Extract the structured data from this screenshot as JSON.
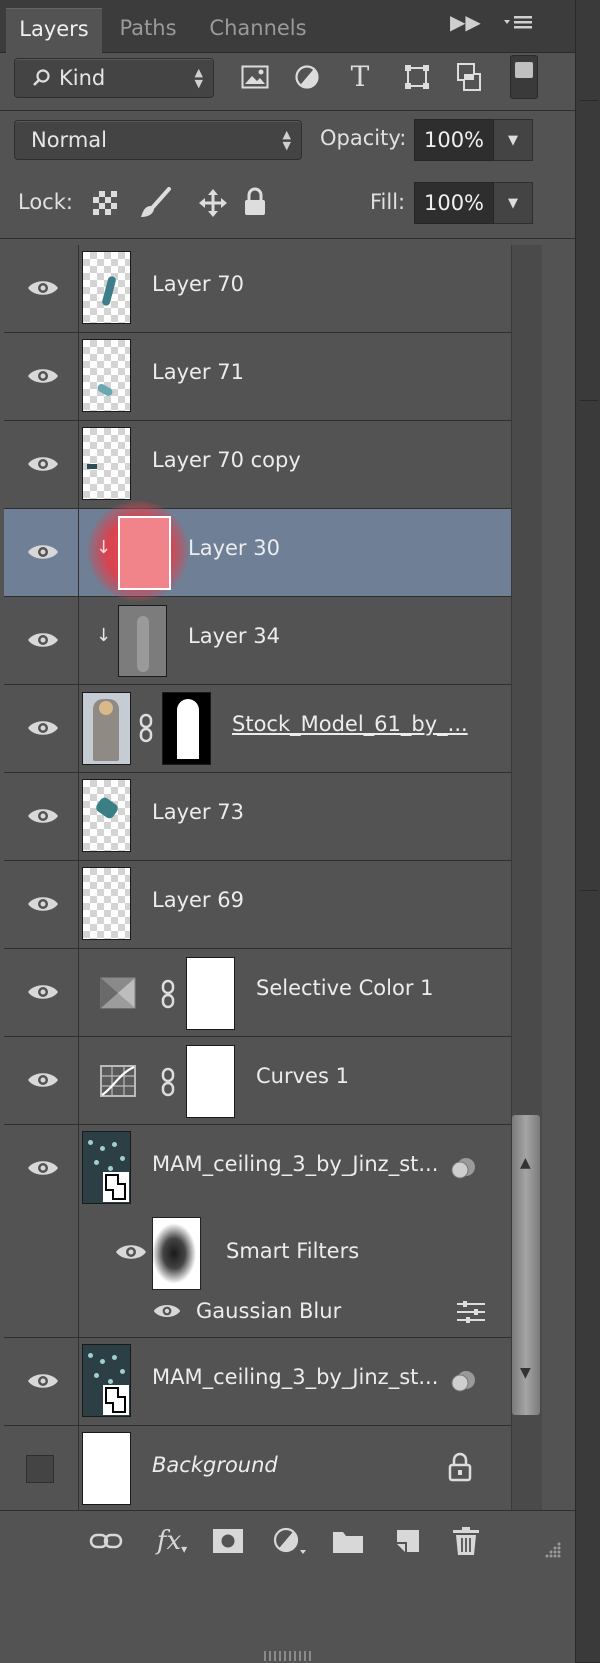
{
  "tabs": [
    "Layers",
    "Paths",
    "Channels"
  ],
  "active_tab": "Layers",
  "filter": {
    "label": "Kind"
  },
  "filter_icons": [
    "image-filter-icon",
    "adjustment-filter-icon",
    "type-filter-icon",
    "shape-filter-icon",
    "smart-object-filter-icon",
    "filter-toggle-icon"
  ],
  "blend": {
    "mode": "Normal",
    "opacity_label": "Opacity:",
    "opacity_value": "100%"
  },
  "lock": {
    "label": "Lock:",
    "fill_label": "Fill:",
    "fill_value": "100%"
  },
  "layers": [
    {
      "name": "Layer 70",
      "visible": true
    },
    {
      "name": "Layer 71",
      "visible": true
    },
    {
      "name": "Layer 70 copy",
      "visible": true
    },
    {
      "name": "Layer 30",
      "visible": true,
      "selected": true,
      "clipped": true
    },
    {
      "name": "Layer 34",
      "visible": true,
      "clipped": true
    },
    {
      "name": "Stock_Model_61_by_...",
      "visible": true
    },
    {
      "name": "Layer 73",
      "visible": true
    },
    {
      "name": "Layer 69",
      "visible": true
    },
    {
      "name": "Selective Color 1",
      "visible": true
    },
    {
      "name": "Curves 1",
      "visible": true
    },
    {
      "name": "MAM_ceiling_3_by_Jinz_st...",
      "visible": true,
      "smart_object": true
    },
    {
      "name": "Smart Filters",
      "visible": true
    },
    {
      "name": "Gaussian Blur",
      "visible": true
    },
    {
      "name": "MAM_ceiling_3_by_Jinz_st...",
      "visible": true,
      "smart_object": true
    },
    {
      "name": "Background",
      "visible": false,
      "locked": true
    }
  ],
  "bottom_icons": [
    "link-layers-icon",
    "fx-icon",
    "add-mask-icon",
    "adjustment-layer-icon",
    "new-group-icon",
    "new-layer-icon",
    "delete-layer-icon"
  ],
  "colors": {
    "panel": "#535353",
    "selected_row": "#6f7f96",
    "dark_field": "#2e2e2e"
  }
}
